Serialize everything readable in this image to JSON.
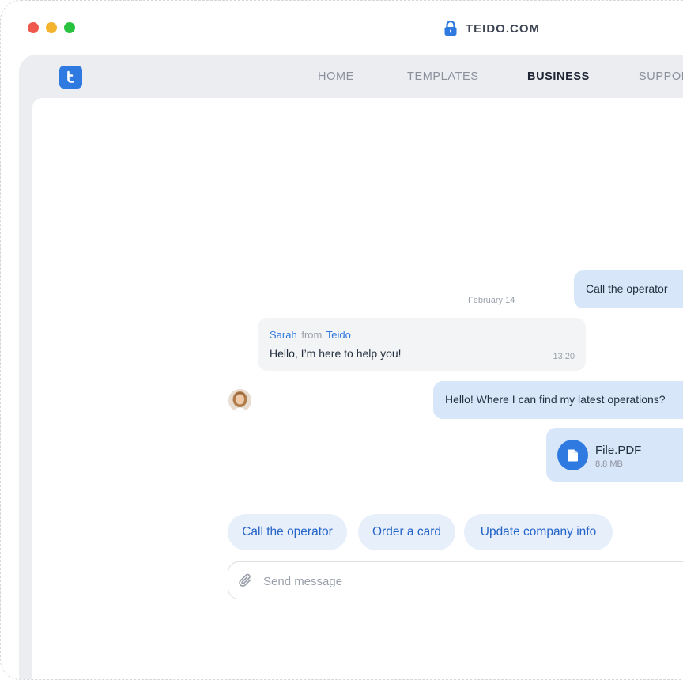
{
  "browser": {
    "url": "TEIDO.COM"
  },
  "nav": {
    "items": [
      {
        "label": "HOME",
        "active": false
      },
      {
        "label": "TEMPLATES",
        "active": false
      },
      {
        "label": "BUSINESS",
        "active": true
      },
      {
        "label": "SUPPORT",
        "active": false
      }
    ]
  },
  "chat": {
    "date": "February 14",
    "messages": {
      "out_1": "Call the operator",
      "in_1": {
        "sender": "Sarah",
        "from_word": "from",
        "company": "Teido",
        "text": "Hello, I’m here to help you!",
        "time": "13:20"
      },
      "out_2": "Hello! Where I can find my latest operations?",
      "file": {
        "name": "File.PDF",
        "size": "8.8 MB"
      }
    },
    "quick_replies": [
      "Call the operator",
      "Order a card",
      "Update company info"
    ],
    "composer": {
      "placeholder": "Send message"
    }
  },
  "colors": {
    "accent": "#2f7ae0",
    "outgoing_bubble": "#d8e6fa",
    "incoming_bubble": "#f3f4f6",
    "chip_bg": "#e7effb",
    "chip_text": "#2564c7"
  },
  "icons": [
    "lock-icon",
    "teido-logo-icon",
    "file-icon",
    "paperclip-icon"
  ]
}
